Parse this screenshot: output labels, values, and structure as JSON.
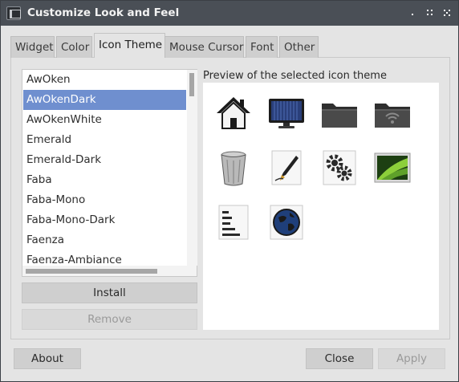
{
  "window": {
    "title": "Customize Look and Feel",
    "buttons": [
      "window-menu-icon",
      "maximize-icon",
      "close-icon"
    ]
  },
  "tabs": [
    {
      "label": "Widget",
      "active": false
    },
    {
      "label": "Color",
      "active": false
    },
    {
      "label": "Icon Theme",
      "active": true
    },
    {
      "label": "Mouse Cursor",
      "active": false
    },
    {
      "label": "Font",
      "active": false
    },
    {
      "label": "Other",
      "active": false
    }
  ],
  "theme_list": {
    "items": [
      "AwOken",
      "AwOkenDark",
      "AwOkenWhite",
      "Emerald",
      "Emerald-Dark",
      "Faba",
      "Faba-Mono",
      "Faba-Mono-Dark",
      "Faenza",
      "Faenza-Ambiance"
    ],
    "selected": "AwOkenDark"
  },
  "actions": {
    "install_label": "Install",
    "remove_label": "Remove"
  },
  "preview": {
    "label": "Preview of the selected icon theme",
    "icons": [
      "home-icon",
      "monitor-icon",
      "folder-icon",
      "network-folder-icon",
      "trash-icon",
      "text-editor-icon",
      "settings-gears-icon",
      "image-viewer-icon",
      "document-text-icon",
      "globe-icon"
    ]
  },
  "footer": {
    "about_label": "About",
    "close_label": "Close",
    "apply_label": "Apply"
  },
  "colors": {
    "titlebar": "#4a4f56",
    "selection": "#6f8fcf",
    "tab_inactive": "#cfcfcf",
    "window_bg": "#e4e4e4"
  }
}
